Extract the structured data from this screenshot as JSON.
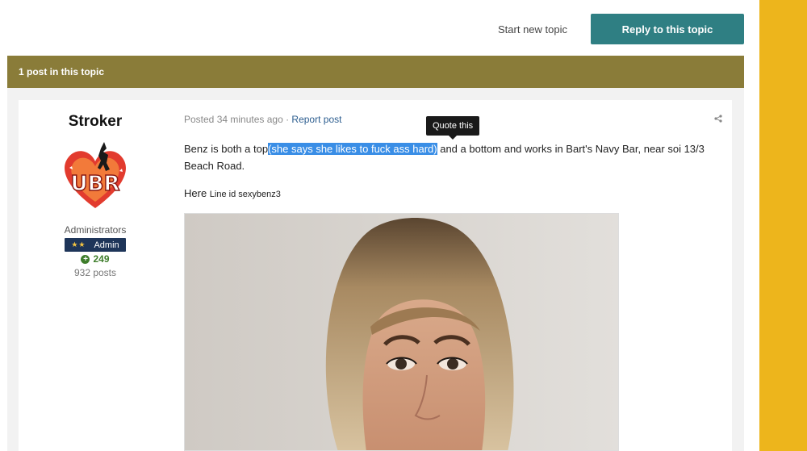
{
  "actions": {
    "start_topic": "Start new topic",
    "reply": "Reply to this topic"
  },
  "topic": {
    "header": "1 post in this topic"
  },
  "author": {
    "name": "Stroker",
    "group": "Administrators",
    "rank": "Admin",
    "rank_stars": "★★",
    "reputation": "249",
    "posts": "932 posts"
  },
  "post": {
    "meta_posted": "Posted 34 minutes ago",
    "meta_sep": " · ",
    "report": "Report post",
    "tooltip": "Quote this",
    "text_before": "Benz is both a top",
    "text_highlight": "(she says she likes to fuck ass hard)",
    "text_after": " and a bottom and works in Bart's Navy Bar, near soi 13/3 Beach Road.",
    "line2_main": "Here ",
    "line2_small": "Line id sexybenz3"
  },
  "colors": {
    "accent": "#2f7f83",
    "header_bg": "#8a7c39",
    "side_bar": "#edb51c",
    "highlight": "#3a8ee6"
  }
}
